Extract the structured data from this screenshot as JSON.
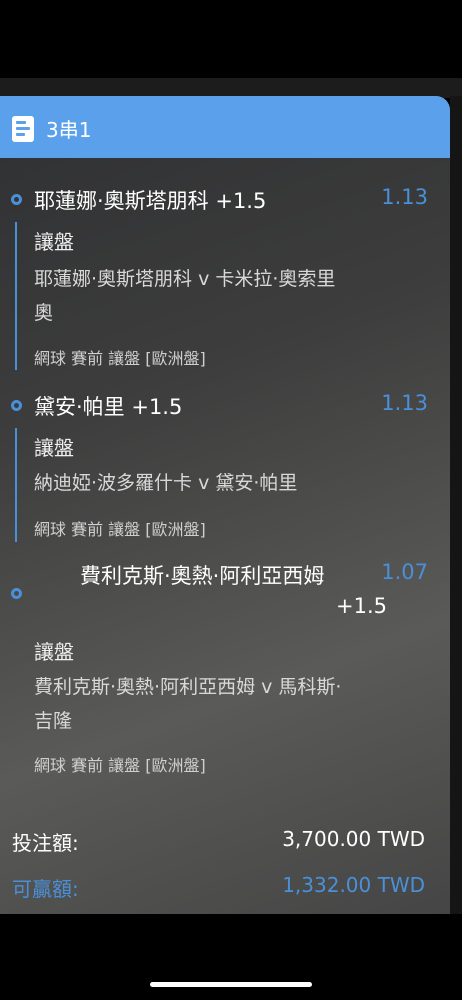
{
  "header": {
    "title": "3串1"
  },
  "legs": [
    {
      "selection": "耶蓮娜·奧斯塔朋科 +1.5",
      "odds": "1.13",
      "market": "讓盤",
      "match_line1": "耶蓮娜·奧斯塔朋科 v 卡米拉·奧索里",
      "match_line2": "奧",
      "meta": "網球 賽前   讓盤 [歐洲盤]"
    },
    {
      "selection": "黛安·帕里 +1.5",
      "odds": "1.13",
      "market": "讓盤",
      "match_line1": "納迪婭·波多羅什卡 v 黛安·帕里",
      "meta": "網球 賽前   讓盤 [歐洲盤]"
    },
    {
      "selection_line1": "費利克斯·奧熱·阿利亞西姆",
      "selection_line2": "+1.5",
      "odds": "1.07",
      "market": "讓盤",
      "match_line1": "費利克斯·奧熱·阿利亞西姆 v 馬科斯·",
      "match_line2": "吉隆",
      "meta": "網球 賽前   讓盤 [歐洲盤]"
    }
  ],
  "summary": {
    "stake_label": "投注額:",
    "stake_value": "3,700.00 TWD",
    "win_label": "可贏額:",
    "win_value": "1,332.00 TWD"
  },
  "colors": {
    "accent": "#4a90d9",
    "header": "#5aa0ea"
  }
}
